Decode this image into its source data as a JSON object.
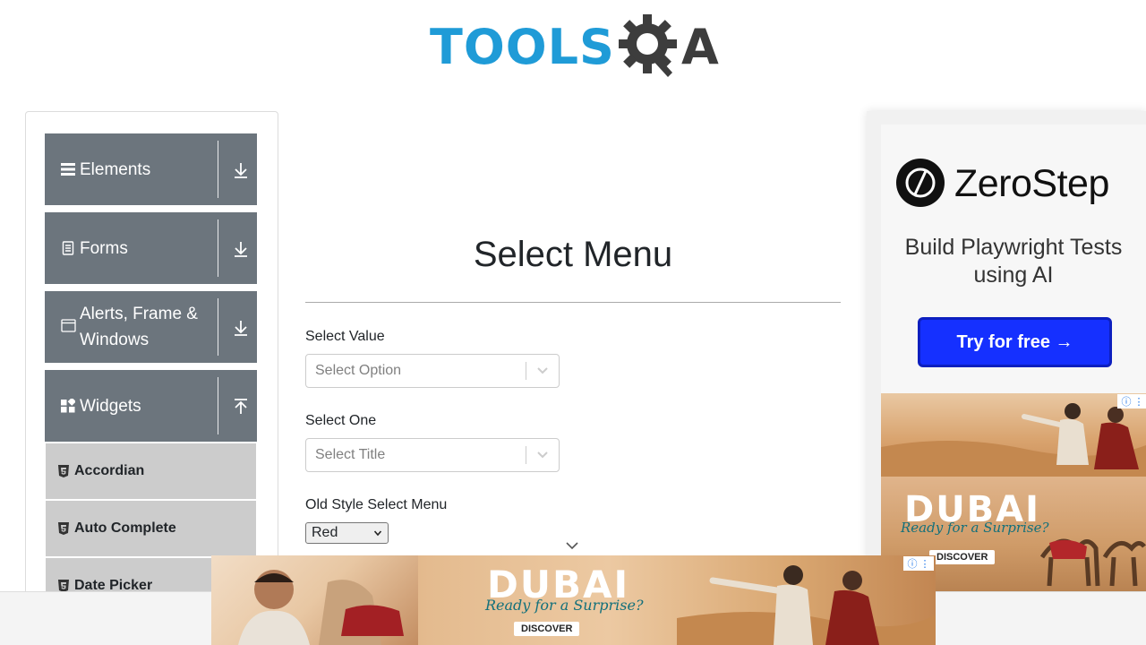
{
  "header": {
    "logo_text_tools": "TOOLS",
    "logo_text_a": "A",
    "brand_color": "#1f9bd7"
  },
  "sidebar": {
    "groups": [
      {
        "label": "Elements",
        "icon": "hamburger-icon",
        "arrow": "download-arrow-icon"
      },
      {
        "label": "Forms",
        "icon": "document-icon",
        "arrow": "download-arrow-icon"
      },
      {
        "label": "Alerts, Frame & Windows",
        "icon": "window-icon",
        "arrow": "download-arrow-icon"
      },
      {
        "label": "Widgets",
        "icon": "widgets-icon",
        "arrow": "upload-arrow-icon"
      }
    ],
    "items": [
      {
        "label": "Accordian",
        "icon": "html5-icon"
      },
      {
        "label": "Auto Complete",
        "icon": "html5-icon"
      },
      {
        "label": "Date Picker",
        "icon": "html5-icon"
      }
    ],
    "group_color": "#6c757d",
    "item_color": "#cccccc"
  },
  "main": {
    "title": "Select Menu",
    "select_value": {
      "label": "Select Value",
      "placeholder": "Select Option"
    },
    "select_one": {
      "label": "Select One",
      "placeholder": "Select Title"
    },
    "old_style": {
      "label": "Old Style Select Menu",
      "selected": "Red"
    }
  },
  "ads": {
    "zerostep": {
      "name": "ZeroStep",
      "text": "Build Playwright Tests using AI",
      "cta": "Try for free →",
      "cta_color": "#1530ff"
    },
    "dubai": {
      "word": "DUBAI",
      "tagline": "Ready for a Surprise?",
      "cta": "DISCOVER"
    }
  }
}
